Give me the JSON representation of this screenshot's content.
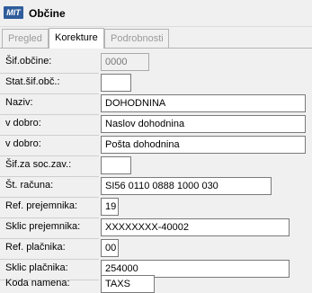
{
  "window": {
    "title": "Občine",
    "icon_text": "MIT",
    "icon_name": "app-logo-icon"
  },
  "tabs": [
    {
      "label": "Pregled",
      "active": false
    },
    {
      "label": "Korekture",
      "active": true
    },
    {
      "label": "Podrobnosti",
      "active": false
    }
  ],
  "form": {
    "sif_obcine": {
      "label": "Šif.občine:",
      "value": "0000"
    },
    "stat_sif_obc": {
      "label": "Stat.šif.obč.:",
      "value": ""
    },
    "naziv": {
      "label": "Naziv:",
      "value": "DOHODNINA"
    },
    "v_dobro_1": {
      "label": "v dobro:",
      "value": "Naslov dohodnina"
    },
    "v_dobro_2": {
      "label": "v dobro:",
      "value": "Pošta dohodnina"
    },
    "sif_soc_zav": {
      "label": "Šif.za soc.zav.:",
      "value": ""
    },
    "st_racuna": {
      "label": "Št. računa:",
      "value": "SI56 0110 0888 1000 030"
    },
    "ref_prejemnika": {
      "label": "Ref. prejemnika:",
      "value": "19"
    },
    "sklic_prejemnika": {
      "label": "Sklic prejemnika:",
      "value": "XXXXXXXX-40002"
    },
    "ref_placnika": {
      "label": "Ref. plačnika:",
      "value": "00"
    },
    "sklic_placnika": {
      "label": "Sklic plačnika:",
      "value": "254000"
    },
    "koda_namena": {
      "label": "Koda namena:",
      "value": "TAXS"
    }
  }
}
